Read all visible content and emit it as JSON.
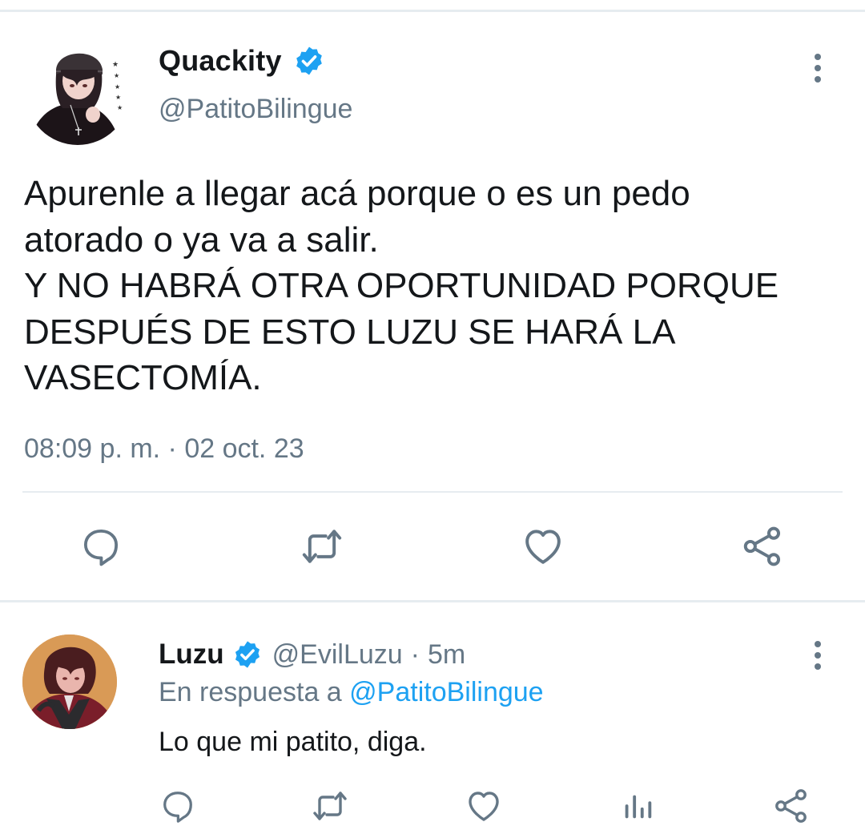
{
  "main_tweet": {
    "display_name": "Quackity",
    "handle": "@PatitoBilingue",
    "text": "Apurenle a llegar acá porque o es un pedo\natorado o ya va a salir.\nY NO HABRÁ OTRA OPORTUNIDAD PORQUE\nDESPUÉS DE ESTO LUZU SE HARÁ LA\nVASECTOMÍA.",
    "timestamp": "08:09 p. m. · 02 oct. 23",
    "verified": true,
    "actions": [
      "reply-icon",
      "retweet-icon",
      "like-icon",
      "share-icon"
    ]
  },
  "reply_tweet": {
    "display_name": "Luzu",
    "handle": "@EvilLuzu",
    "separator": "·",
    "time": "5m",
    "reply_prefix": "En respuesta a",
    "reply_mention": "@PatitoBilingue",
    "text": "Lo que mi patito, diga.",
    "verified": true,
    "actions": [
      "reply-icon",
      "retweet-icon",
      "like-icon",
      "analytics-icon",
      "share-icon"
    ]
  },
  "colors": {
    "text_primary": "#14171a",
    "text_secondary": "#657786",
    "accent": "#1da1f2",
    "divider": "#e6ecf0"
  }
}
